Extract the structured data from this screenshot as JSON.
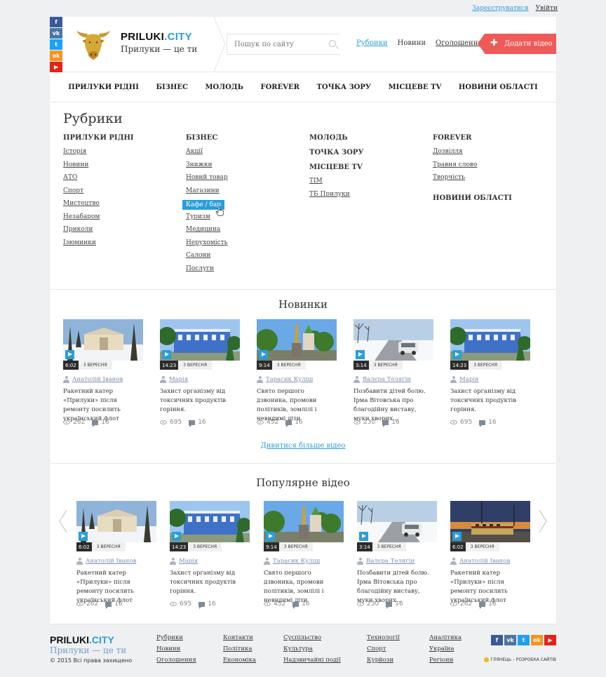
{
  "top_links": {
    "register": "Зареєструватися",
    "login": "Увійти"
  },
  "social": [
    {
      "icon": "facebook-icon",
      "glyph": "f",
      "color": "#3b5998"
    },
    {
      "icon": "vk-icon",
      "glyph": "vk",
      "color": "#4c75a3"
    },
    {
      "icon": "twitter-icon",
      "glyph": "t",
      "color": "#1da1f2"
    },
    {
      "icon": "odnoklassniki-icon",
      "glyph": "ok",
      "color": "#f7931e"
    },
    {
      "icon": "youtube-icon",
      "glyph": "▶",
      "color": "#e62117"
    }
  ],
  "header": {
    "logo_main": "PRILUKI",
    "logo_dot": ".CITY",
    "tagline": "Прилуки — це ти",
    "search_placeholder": "Пошук по сайту",
    "nav": [
      "Рубрики",
      "Новини",
      "Оголошення"
    ],
    "add_video": "Додати відео"
  },
  "category_nav": [
    "ПРИЛУКИ РІДНІ",
    "БІЗНЕС",
    "МОЛОДЬ",
    "FOREVER",
    "ТОЧКА ЗОРУ",
    "МІСЦЕВЕ TV",
    "НОВИНИ ОБЛАСТІ"
  ],
  "rubrics": {
    "title": "Рубрики",
    "col1": {
      "head": "ПРИЛУКИ РІДНІ",
      "items": [
        "Історія",
        "Новини",
        "АТО",
        "Спорт",
        "Мистецтво",
        "Незабаром",
        "Приколи",
        "Ізюминки"
      ]
    },
    "col2": {
      "head": "БІЗНЕС",
      "items": [
        "Акції",
        "Знижки",
        "Новий товар",
        "Магазини",
        "Кафе / бар",
        "Туризм",
        "Медицина",
        "Нерухомість",
        "Салони",
        "Послуги"
      ],
      "highlight_index": 4
    },
    "col3": [
      {
        "head": "МОЛОДЬ",
        "items": []
      },
      {
        "head": "ТОЧКА ЗОРУ",
        "items": []
      },
      {
        "head": "МІСЦЕВЕ TV",
        "items": [
          "TIM",
          "ТБ Прилуки"
        ]
      }
    ],
    "col4": [
      {
        "head": "FOREVER",
        "items": [
          "Дозвілля",
          "Травня слово",
          "Творчість"
        ]
      },
      {
        "head": "НОВИНИ ОБЛАСТІ",
        "items": []
      }
    ]
  },
  "news": {
    "title": "Новинки",
    "more": "Дивитися більше відео",
    "videos": [
      {
        "duration": "6:02",
        "date": "3 ВЕРЕСНЯ",
        "author": "Анатолій Іванов",
        "title": "Ракетний катер «Прилуки» після ремонту посилить український флот",
        "views": "262",
        "comments": "16",
        "thumb": "palace"
      },
      {
        "duration": "14:23",
        "date": "3 ВЕРЕСНЯ",
        "author": "Марія",
        "title": "Захист організму від токсичних продуктів горіння.",
        "views": "695",
        "comments": "16",
        "thumb": "building"
      },
      {
        "duration": "9:14",
        "date": "3 ВЕРЕСНЯ",
        "author": "Тарасик Куліш",
        "title": "Свято першого дзвоника, промови політиків, зомлілі і невидимі діти",
        "views": "452",
        "comments": "16",
        "thumb": "statue"
      },
      {
        "duration": "3:14",
        "date": "3 ВЕРЕСНЯ",
        "author": "Валєра Телягін",
        "title": "Позбавити дітей болю. Ірма Вітовська про благодійну виставу, муки хворих…",
        "views": "230",
        "comments": "16",
        "thumb": "snowcar"
      },
      {
        "duration": "14:23",
        "date": "3 ВЕРЕСНЯ",
        "author": "Марія",
        "title": "Захист організму від токсичних продуктів горіння.",
        "views": "695",
        "comments": "16",
        "thumb": "building"
      }
    ]
  },
  "popular": {
    "title": "Популярне відео",
    "videos": [
      {
        "duration": "6:02",
        "date": "3 ВЕРЕСНЯ",
        "author": "Анатолій Іванов",
        "title": "Ракетний катер «Прилуки» після ремонту посилить український флот",
        "views": "262",
        "comments": "16",
        "thumb": "palace"
      },
      {
        "duration": "14:23",
        "date": "3 ВЕРЕСНЯ",
        "author": "Марія",
        "title": "Захист організму від токсичних продуктів горіння.",
        "views": "695",
        "comments": "16",
        "thumb": "building"
      },
      {
        "duration": "9:14",
        "date": "3 ВЕРЕСНЯ",
        "author": "Тарасик Куліш",
        "title": "Свято першого дзвоника, промови політиків, зомлілі і невидимі діти",
        "views": "452",
        "comments": "16",
        "thumb": "statue"
      },
      {
        "duration": "3:14",
        "date": "3 ВЕРЕСНЯ",
        "author": "Валєра Телягін",
        "title": "Позбавити дітей болю. Ірма Вітовська про благодійну виставу, муки хворих…",
        "views": "230",
        "comments": "16",
        "thumb": "snowcar"
      },
      {
        "duration": "6:02",
        "date": "3 ВЕРЕСНЯ",
        "author": "Анатолій Іванов",
        "title": "Ракетний катер «Прилуки» після ремонту посилить український флот",
        "views": "262",
        "comments": "16",
        "thumb": "train"
      }
    ]
  },
  "footer": {
    "logo_main": "PRILUKI",
    "logo_dot": ".CITY",
    "tagline": "Прилуки — це ти",
    "copyright": "© 2015 Всі права захищено",
    "columns": [
      [
        "Рубрики",
        "Новини",
        "Оголошення"
      ],
      [
        "Контакти",
        "Політика",
        "Економіка"
      ],
      [
        "Суспільство",
        "Культура",
        "Надзвичайні події"
      ],
      [
        "Технології",
        "Спорт",
        "Курйози"
      ],
      [
        "Аналітика",
        "Україна",
        "Регіони"
      ]
    ],
    "developer": "ГЛЯНЕЦЬ – РОЗРОБКА САЙТІВ"
  }
}
